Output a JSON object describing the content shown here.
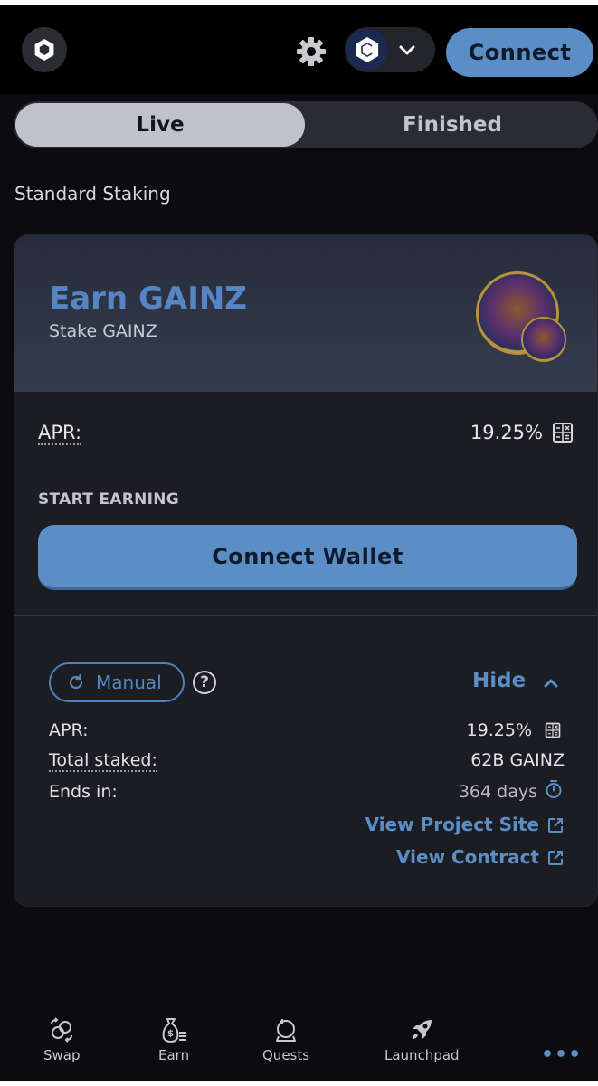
{
  "header": {
    "connect_label": "Connect",
    "logo_icon": "app-logo-icon",
    "settings_icon": "gear-icon",
    "chain_icon": "cronos-chain-icon"
  },
  "tabs": [
    {
      "label": "Live",
      "active": true
    },
    {
      "label": "Finished",
      "active": false
    }
  ],
  "section_title": "Standard Staking",
  "pool": {
    "title": "Earn GAINZ",
    "subtitle": "Stake GAINZ",
    "apr_label": "APR:",
    "apr_value": "19.25%",
    "start_earning": "START EARNING",
    "connect_wallet": "Connect Wallet",
    "manual_label": "Manual",
    "hide_label": "Hide",
    "details": {
      "apr_label": "APR:",
      "apr_value": "19.25%",
      "total_staked_label": "Total staked:",
      "total_staked_value": "62B GAINZ",
      "ends_in_label": "Ends in:",
      "ends_in_value": "364 days"
    },
    "view_project_site": "View Project Site",
    "view_contract": "View Contract"
  },
  "colors": {
    "accent": "#5b8ec6",
    "background": "#0c0c10",
    "card": "#1c1d22"
  },
  "bottom_nav": [
    {
      "label": "Swap",
      "icon": "swap-icon"
    },
    {
      "label": "Earn",
      "icon": "money-bag-icon"
    },
    {
      "label": "Quests",
      "icon": "quests-icon"
    },
    {
      "label": "Launchpad",
      "icon": "rocket-icon"
    },
    {
      "label": "",
      "icon": "more-icon"
    }
  ],
  "more_glyph": "•••"
}
